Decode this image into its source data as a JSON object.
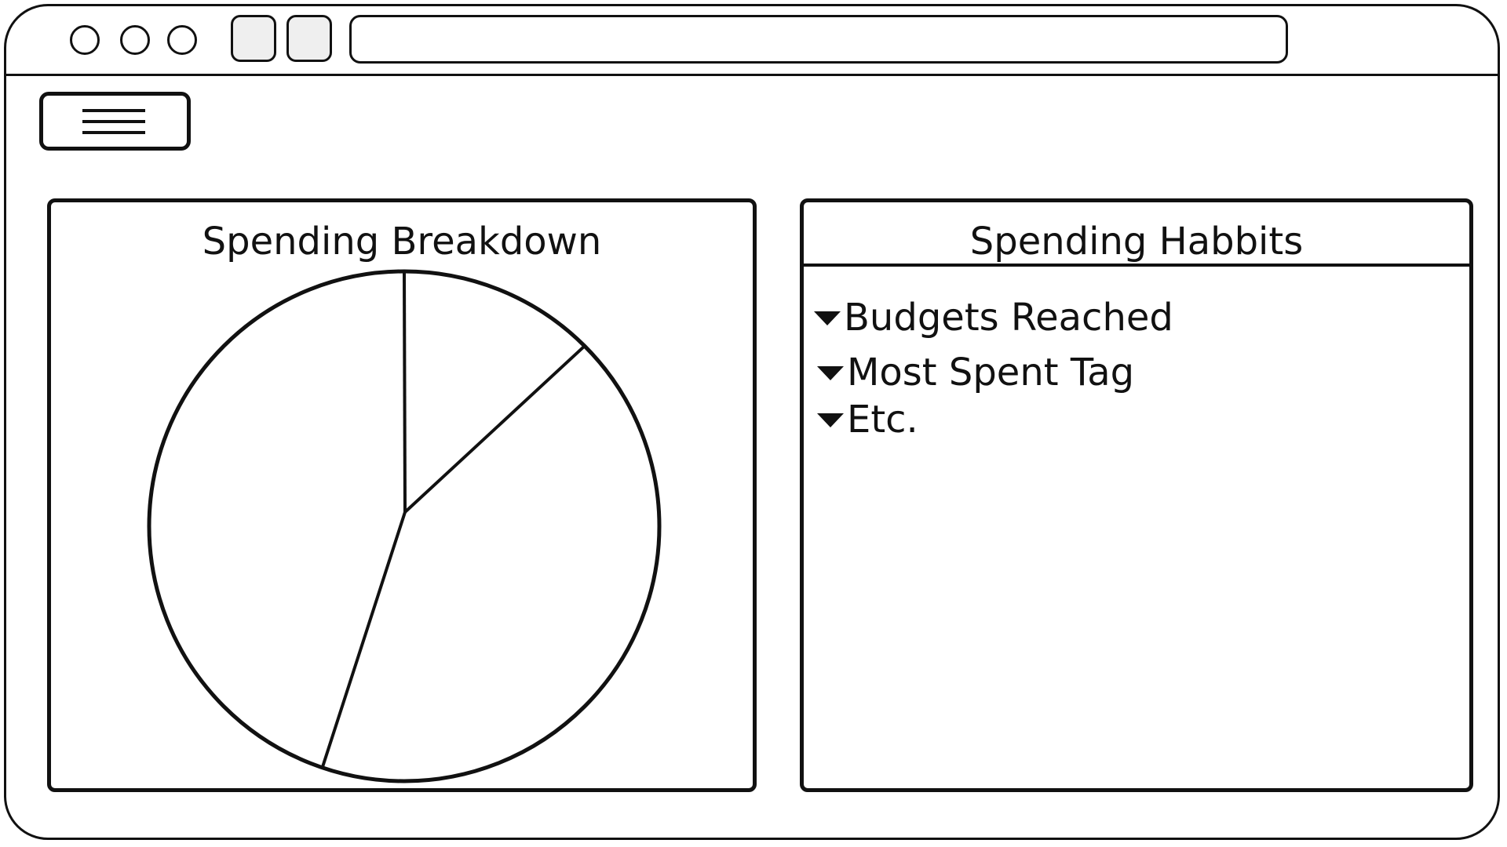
{
  "browser": {
    "address": ""
  },
  "icons": {
    "window_controls": [
      "circle-icon",
      "circle-icon",
      "circle-icon"
    ],
    "menu": "hamburger-menu-icon",
    "list_marker": "triangle-down-icon"
  },
  "colors": {
    "stroke": "#111111",
    "background": "#ffffff"
  },
  "spending_breakdown": {
    "title": "Spending Breakdown"
  },
  "chart_data": {
    "type": "pie",
    "title": "Spending Breakdown",
    "slices": [
      {
        "label": "",
        "value": 12.5
      },
      {
        "label": "",
        "value": 42.7
      },
      {
        "label": "",
        "value": 44.8
      }
    ]
  },
  "spending_habits": {
    "title": "Spending Habbits",
    "items": [
      {
        "label": "Budgets Reached"
      },
      {
        "label": "Most Spent Tag"
      },
      {
        "label": "Etc."
      }
    ]
  }
}
